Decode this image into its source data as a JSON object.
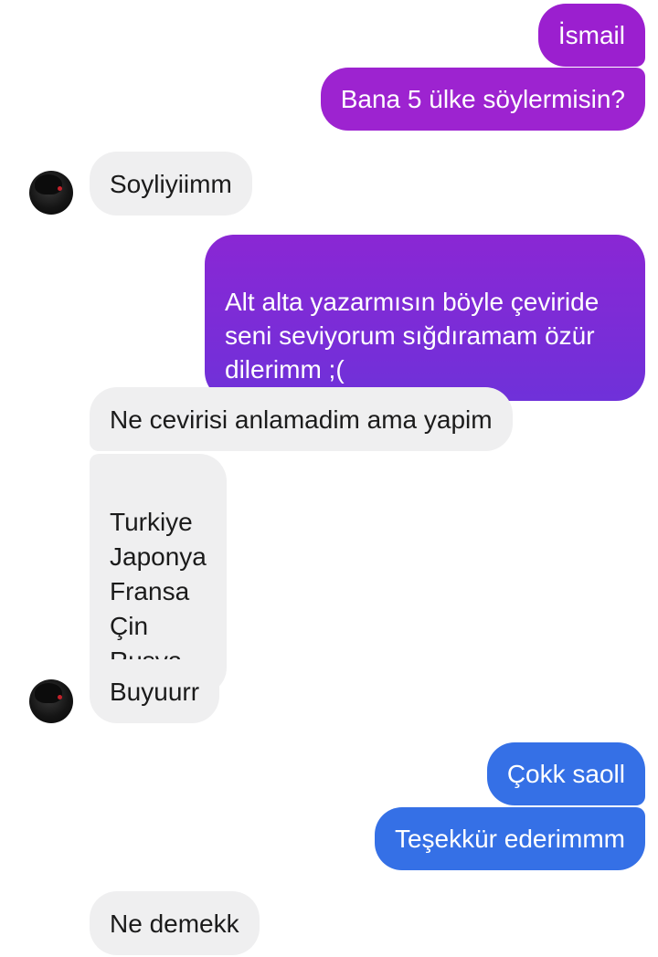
{
  "conversation": {
    "messages": [
      {
        "side": "out",
        "text": "İsmail",
        "color": "#9b1fcf"
      },
      {
        "side": "out",
        "text": "Bana 5 ülke söylermisin?",
        "color": "#9b1fcf"
      },
      {
        "side": "in",
        "text": "Soyliyiimm"
      },
      {
        "side": "out",
        "text": "Alt alta yazarmısın böyle çeviride\nseni seviyorum sığdıramam özür\ndilerimm ;(",
        "color": "#7b2bd6"
      },
      {
        "side": "in",
        "text": "Ne cevirisi anlamadim ama yapim"
      },
      {
        "side": "in",
        "text": "Turkiye\nJaponya\nFransa\nÇin\nRusya"
      },
      {
        "side": "in",
        "text": "Buyuurr"
      },
      {
        "side": "out",
        "text": "Çokk saoll",
        "color": "#3570e6"
      },
      {
        "side": "out",
        "text": "Teşekkür ederimmm",
        "color": "#3570e6"
      },
      {
        "side": "in",
        "text": "Ne demekk"
      }
    ]
  },
  "colors": {
    "incoming_bubble": "#efeff0",
    "incoming_text": "#1b1b1b",
    "outgoing_purple": "#9b1fcf",
    "outgoing_violet": "#7b2bd6",
    "outgoing_blue": "#3570e6"
  }
}
